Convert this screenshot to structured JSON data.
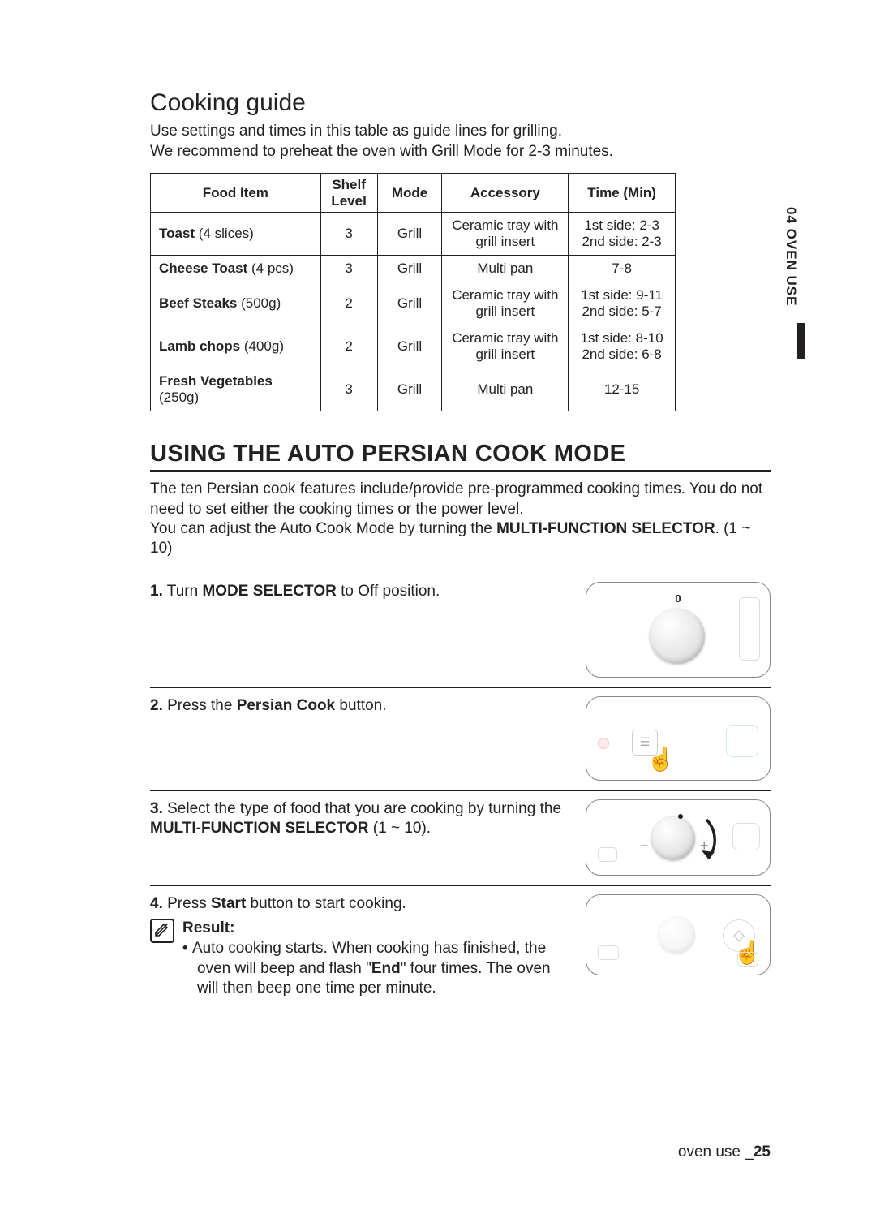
{
  "side_tab": "04 OVEN USE",
  "cooking_guide": {
    "heading": "Cooking guide",
    "intro_line1": "Use settings and times in this table as guide lines for grilling.",
    "intro_line2": "We recommend to preheat the oven with Grill Mode for 2-3 minutes.",
    "headers": {
      "food": "Food Item",
      "shelf": "Shelf Level",
      "mode": "Mode",
      "accessory": "Accessory",
      "time": "Time (Min)"
    },
    "rows": [
      {
        "name": "Toast",
        "qty": " (4 slices)",
        "shelf": "3",
        "mode": "Grill",
        "accessory": "Ceramic tray with grill insert",
        "time": "1st side: 2-3\n2nd side: 2-3"
      },
      {
        "name": "Cheese Toast",
        "qty": " (4 pcs)",
        "shelf": "3",
        "mode": "Grill",
        "accessory": "Multi pan",
        "time": "7-8"
      },
      {
        "name": "Beef Steaks",
        "qty": " (500g)",
        "shelf": "2",
        "mode": "Grill",
        "accessory": "Ceramic tray with grill insert",
        "time": "1st side: 9-11\n2nd side: 5-7"
      },
      {
        "name": "Lamb chops",
        "qty": " (400g)",
        "shelf": "2",
        "mode": "Grill",
        "accessory": "Ceramic tray with grill insert",
        "time": "1st side: 8-10\n2nd side: 6-8"
      },
      {
        "name": "Fresh Vegetables",
        "qty": " (250g)",
        "shelf": "3",
        "mode": "Grill",
        "accessory": "Multi pan",
        "time": "12-15"
      }
    ]
  },
  "auto_mode": {
    "heading": "USING THE AUTO PERSIAN COOK MODE",
    "para1": "The ten Persian cook features include/provide pre-programmed cooking times. You do not need to set either the cooking times or the power level.",
    "para2_a": "You can adjust the Auto Cook Mode by turning the ",
    "para2_b": "MULTI-FUNCTION SELECTOR",
    "para2_c": ". (1 ~ 10)",
    "steps": {
      "s1_num": "1.",
      "s1_a": " Turn ",
      "s1_b": "MODE SELECTOR",
      "s1_c": " to Off position.",
      "s1_zero": "0",
      "s2_num": "2.",
      "s2_a": " Press the ",
      "s2_b": "Persian Cook",
      "s2_c": " button.",
      "s3_num": "3.",
      "s3_a": " Select the type of food that you are cooking by turning the ",
      "s3_b": "MULTI-FUNCTION SELECTOR",
      "s3_c": " (1 ~ 10).",
      "s4_num": "4.",
      "s4_a": " Press ",
      "s4_b": "Start",
      "s4_c": " button to start cooking.",
      "result_label": "Result:",
      "result_text_a": "Auto cooking starts. When cooking has finished, the oven will beep and flash \"",
      "result_text_b": "End",
      "result_text_c": "\" four times. The oven will then beep one time per minute."
    }
  },
  "footer": {
    "label": "oven use _",
    "page": "25"
  }
}
